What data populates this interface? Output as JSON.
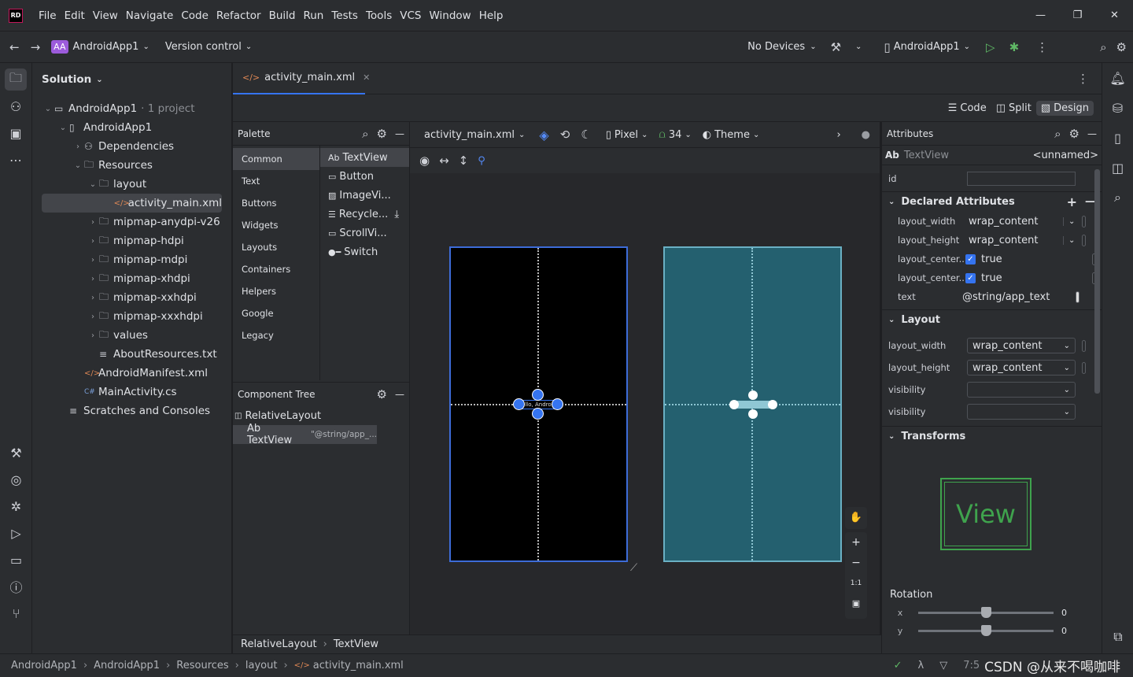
{
  "app": {
    "logo": "RD",
    "menu": [
      "File",
      "Edit",
      "View",
      "Navigate",
      "Code",
      "Refactor",
      "Build",
      "Run",
      "Tests",
      "Tools",
      "VCS",
      "Window",
      "Help"
    ]
  },
  "toolbar": {
    "project_badge": "AA",
    "project": "AndroidApp1",
    "vcs": "Version control",
    "devices": "No Devices",
    "run_config": "AndroidApp1"
  },
  "project_panel": {
    "title": "Solution",
    "items": [
      {
        "label": "AndroidApp1",
        "suffix": "· 1 project",
        "depth": 0,
        "chev": "v",
        "icon": "solution"
      },
      {
        "label": "AndroidApp1",
        "depth": 1,
        "chev": "v",
        "icon": "project"
      },
      {
        "label": "Dependencies",
        "depth": 2,
        "chev": ">",
        "icon": "deps"
      },
      {
        "label": "Resources",
        "depth": 2,
        "chev": "v",
        "icon": "folder"
      },
      {
        "label": "layout",
        "depth": 3,
        "chev": "v",
        "icon": "folder"
      },
      {
        "label": "activity_main.xml",
        "depth": 4,
        "chev": "",
        "icon": "xml",
        "selected": true
      },
      {
        "label": "mipmap-anydpi-v26",
        "depth": 3,
        "chev": ">",
        "icon": "folder"
      },
      {
        "label": "mipmap-hdpi",
        "depth": 3,
        "chev": ">",
        "icon": "folder"
      },
      {
        "label": "mipmap-mdpi",
        "depth": 3,
        "chev": ">",
        "icon": "folder"
      },
      {
        "label": "mipmap-xhdpi",
        "depth": 3,
        "chev": ">",
        "icon": "folder"
      },
      {
        "label": "mipmap-xxhdpi",
        "depth": 3,
        "chev": ">",
        "icon": "folder"
      },
      {
        "label": "mipmap-xxxhdpi",
        "depth": 3,
        "chev": ">",
        "icon": "folder"
      },
      {
        "label": "values",
        "depth": 3,
        "chev": ">",
        "icon": "folder"
      },
      {
        "label": "AboutResources.txt",
        "depth": 3,
        "chev": "",
        "icon": "text"
      },
      {
        "label": "AndroidManifest.xml",
        "depth": 2,
        "chev": "",
        "icon": "xml"
      },
      {
        "label": "MainActivity.cs",
        "depth": 2,
        "chev": "",
        "icon": "cs"
      },
      {
        "label": "Scratches and Consoles",
        "depth": 1,
        "chev": "",
        "icon": "scratch"
      }
    ]
  },
  "editor": {
    "tab": "activity_main.xml",
    "modes": [
      "Code",
      "Split",
      "Design"
    ],
    "active_mode": "Design"
  },
  "palette": {
    "title": "Palette",
    "categories": [
      "Common",
      "Text",
      "Buttons",
      "Widgets",
      "Layouts",
      "Containers",
      "Helpers",
      "Google",
      "Legacy"
    ],
    "items": [
      {
        "icon": "Ab",
        "label": "TextView"
      },
      {
        "icon": "▭",
        "label": "Button"
      },
      {
        "icon": "▨",
        "label": "ImageVi..."
      },
      {
        "icon": "☰",
        "label": "Recycle..."
      },
      {
        "icon": "▭",
        "label": "ScrollVi..."
      },
      {
        "icon": "●━",
        "label": "Switch"
      }
    ]
  },
  "component_tree": {
    "title": "Component Tree",
    "root": "RelativeLayout",
    "child": "Ab TextView",
    "child_text": "\"@string/app_..."
  },
  "design_toolbar": {
    "file": "activity_main.xml",
    "device": "Pixel",
    "api": "34",
    "theme": "Theme"
  },
  "canvas": {
    "blueprint_color": "#000000",
    "design_color": "#24606f",
    "selection_color": "#3574f0",
    "text_preview": "llo, Andro",
    "zoom_labels": [
      "1:1"
    ]
  },
  "attributes": {
    "title": "Attributes",
    "widget": "TextView",
    "widget_prefix": "Ab",
    "name": "<unnamed>",
    "id_label": "id",
    "declared_title": "Declared Attributes",
    "declared": [
      {
        "k": "layout_width",
        "v": "wrap_content",
        "type": "combo"
      },
      {
        "k": "layout_height",
        "v": "wrap_content",
        "type": "combo"
      },
      {
        "k": "layout_center...",
        "v": "true",
        "type": "check"
      },
      {
        "k": "layout_center...",
        "v": "true",
        "type": "check"
      },
      {
        "k": "text",
        "v": "@string/app_text",
        "type": "text"
      }
    ],
    "layout_title": "Layout",
    "layout": [
      {
        "k": "layout_width",
        "v": "wrap_content"
      },
      {
        "k": "layout_height",
        "v": "wrap_content"
      },
      {
        "k": "visibility",
        "v": ""
      },
      {
        "k": "visibility",
        "v": ""
      }
    ],
    "transforms_title": "Transforms",
    "view_preview": "View",
    "rotation_label": "Rotation",
    "rotation": [
      {
        "axis": "x",
        "value": "0"
      },
      {
        "axis": "y",
        "value": "0"
      }
    ]
  },
  "breadcrumb_bottom": [
    "RelativeLayout",
    "TextView"
  ],
  "status": {
    "path": [
      "AndroidApp1",
      "AndroidApp1",
      "Resources",
      "layout",
      "activity_main.xml"
    ],
    "position": "7:5",
    "watermark": "CSDN @从来不喝咖啡"
  }
}
